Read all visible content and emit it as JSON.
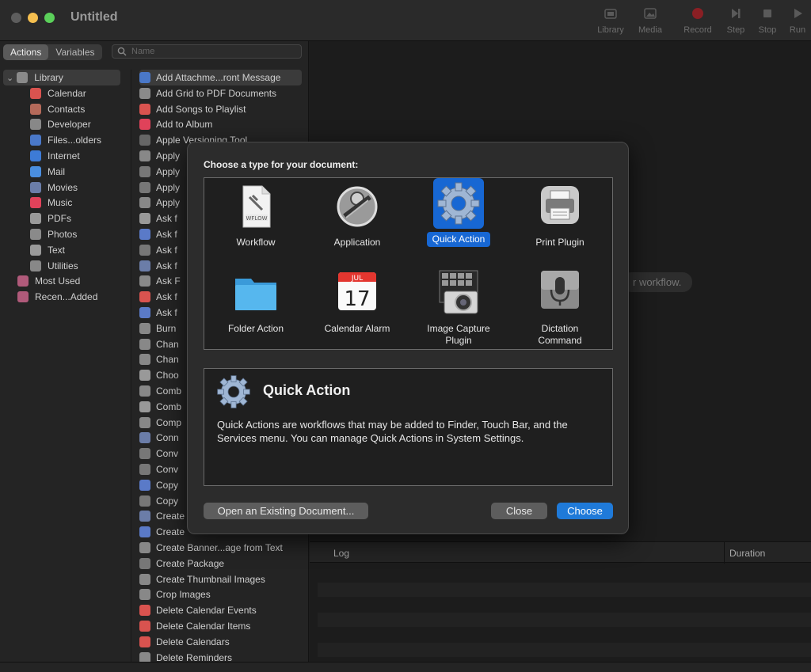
{
  "window": {
    "title": "Untitled"
  },
  "toolbar": [
    {
      "label": "Library",
      "icon": "library-icon"
    },
    {
      "label": "Media",
      "icon": "media-icon"
    },
    {
      "label": "Record",
      "icon": "record-icon"
    },
    {
      "label": "Step",
      "icon": "step-icon"
    },
    {
      "label": "Stop",
      "icon": "stop-icon"
    },
    {
      "label": "Run",
      "icon": "run-icon"
    }
  ],
  "left": {
    "tabs": [
      "Actions",
      "Variables"
    ],
    "search_placeholder": "Name",
    "library": [
      {
        "label": "Library",
        "color": "#8a8a8a"
      },
      {
        "label": "Calendar",
        "color": "#d9534f"
      },
      {
        "label": "Contacts",
        "color": "#b56a5a"
      },
      {
        "label": "Developer",
        "color": "#888888"
      },
      {
        "label": "Files...olders",
        "color": "#4a78c8"
      },
      {
        "label": "Internet",
        "color": "#3d7bd6"
      },
      {
        "label": "Mail",
        "color": "#4a8ee0"
      },
      {
        "label": "Movies",
        "color": "#6b7da8"
      },
      {
        "label": "Music",
        "color": "#e0425a"
      },
      {
        "label": "PDFs",
        "color": "#9a9a9a"
      },
      {
        "label": "Photos",
        "color": "#8a8a8a"
      },
      {
        "label": "Text",
        "color": "#9a9a9a"
      },
      {
        "label": "Utilities",
        "color": "#888888"
      },
      {
        "label": "Most Used",
        "color": "#b05a7a"
      },
      {
        "label": "Recen...Added",
        "color": "#b05a7a"
      }
    ],
    "actions": [
      "Add Attachme...ront Message",
      "Add Grid to PDF Documents",
      "Add Songs to Playlist",
      "Add to Album",
      "Apple Versioning Tool",
      "Apply",
      "Apply",
      "Apply",
      "Apply",
      "Ask f",
      "Ask f",
      "Ask f",
      "Ask f",
      "Ask F",
      "Ask f",
      "Ask f",
      "Burn",
      "Chan",
      "Chan",
      "Choo",
      "Comb",
      "Comb",
      "Comp",
      "Conn",
      "Conv",
      "Conv",
      "Copy",
      "Copy",
      "Create",
      "Create",
      "Create Banner...age from Text",
      "Create Package",
      "Create Thumbnail Images",
      "Crop Images",
      "Delete Calendar Events",
      "Delete Calendar Items",
      "Delete Calendars",
      "Delete Reminders"
    ]
  },
  "right": {
    "hint": "r workflow.",
    "log_label": "Log",
    "duration_label": "Duration"
  },
  "dialog": {
    "heading": "Choose a type for your document:",
    "types": [
      {
        "label": "Workflow",
        "icon": "workflow-document-icon"
      },
      {
        "label": "Application",
        "icon": "automator-robot-icon"
      },
      {
        "label": "Quick Action",
        "icon": "gear-icon",
        "selected": true
      },
      {
        "label": "Print Plugin",
        "icon": "printer-icon"
      },
      {
        "label": "Folder Action",
        "icon": "folder-icon"
      },
      {
        "label": "Calendar Alarm",
        "icon": "calendar-icon",
        "month": "JUL",
        "day": "17"
      },
      {
        "label": "Image Capture Plugin",
        "icon": "camera-photos-icon"
      },
      {
        "label": "Dictation Command",
        "icon": "microphone-icon"
      }
    ],
    "workflow_badge": "WFLOW",
    "detail": {
      "title": "Quick Action",
      "text": "Quick Actions are workflows that may be added to Finder, Touch Bar, and the Services menu. You can manage Quick Actions in System Settings."
    },
    "buttons": {
      "open_existing": "Open an Existing Document...",
      "close": "Close",
      "choose": "Choose"
    }
  }
}
